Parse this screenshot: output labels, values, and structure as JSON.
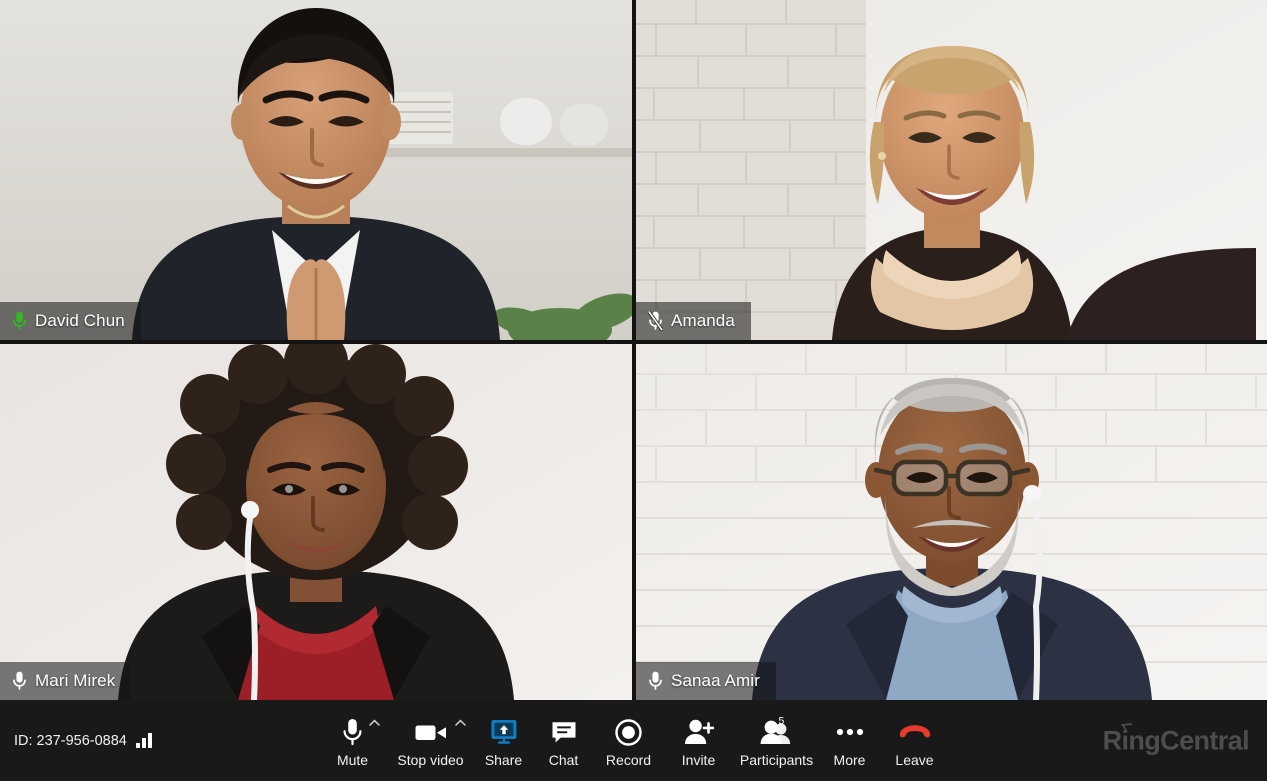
{
  "meeting": {
    "id_label": "ID: 237-956-0884",
    "signal_icon": "signal-bars-icon",
    "brand": {
      "part1": "R",
      "part2": "i",
      "part3": "ngCentral"
    }
  },
  "participants": [
    {
      "name": "David Chun",
      "mic_icon": "microphone-active-icon",
      "mic_state": "speaking",
      "mic_color": "#2fbb1e",
      "active_speaker": true,
      "border_color": "#2fbb1e",
      "position": "top-left"
    },
    {
      "name": "Amanda",
      "mic_icon": "microphone-muted-icon",
      "mic_state": "muted",
      "mic_color": "#ffffff",
      "active_speaker": false,
      "position": "top-right"
    },
    {
      "name": "Mari Mirek",
      "mic_icon": "microphone-icon",
      "mic_state": "unmuted",
      "mic_color": "#ffffff",
      "active_speaker": false,
      "position": "bottom-left"
    },
    {
      "name": "Sanaa Amir",
      "mic_icon": "microphone-icon",
      "mic_state": "unmuted",
      "mic_color": "#ffffff",
      "active_speaker": false,
      "position": "bottom-right"
    }
  ],
  "toolbar": {
    "controls": [
      {
        "label": "Mute",
        "icon": "microphone-icon",
        "caret": true,
        "badge": ""
      },
      {
        "label": "Stop video",
        "icon": "video-camera-icon",
        "caret": true,
        "badge": ""
      },
      {
        "label": "Share",
        "icon": "screen-share-icon",
        "caret": false,
        "badge": "",
        "accent": "#0e7ec4"
      },
      {
        "label": "Chat",
        "icon": "chat-bubble-icon",
        "caret": false,
        "badge": ""
      },
      {
        "label": "Record",
        "icon": "record-circle-icon",
        "caret": false,
        "badge": ""
      },
      {
        "label": "Invite",
        "icon": "person-add-icon",
        "caret": false,
        "badge": ""
      },
      {
        "label": "Participants",
        "icon": "people-icon",
        "caret": false,
        "badge": "5"
      },
      {
        "label": "More",
        "icon": "ellipsis-icon",
        "caret": false,
        "badge": ""
      },
      {
        "label": "Leave",
        "icon": "phone-hangup-icon",
        "caret": false,
        "badge": "",
        "accent": "#e8392f"
      }
    ]
  },
  "colors": {
    "toolbar_bg": "#191919",
    "active_speaker": "#2fbb1e",
    "share_accent": "#0e7ec4",
    "leave_accent": "#e8392f",
    "brand_gray": "#4d4d4d"
  }
}
